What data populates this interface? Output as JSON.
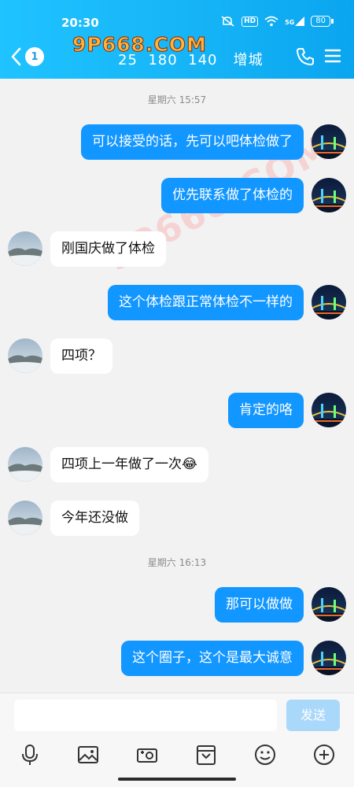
{
  "status_bar": {
    "time": "20:30",
    "network": "5G",
    "battery": "80",
    "hd_label": "HD"
  },
  "header": {
    "back_count": "1",
    "title": "25  180  140   增城"
  },
  "watermark": {
    "logo_text": "9P668.COM",
    "faint_text": "9P668.COM"
  },
  "messages": [
    {
      "type": "time",
      "text": "星期六 15:57"
    },
    {
      "type": "out",
      "text": "可以接受的话，先可以吧体检做了"
    },
    {
      "type": "out",
      "text": "优先联系做了体检的"
    },
    {
      "type": "in",
      "text": "刚国庆做了体检"
    },
    {
      "type": "out",
      "text": "这个体检跟正常体检不一样的"
    },
    {
      "type": "in",
      "text": "四项？"
    },
    {
      "type": "out",
      "text": "肯定的咯"
    },
    {
      "type": "in",
      "text": "四项上一年做了一次😂"
    },
    {
      "type": "in",
      "text": "今年还没做"
    },
    {
      "type": "time",
      "text": "星期六 16:13"
    },
    {
      "type": "out",
      "text": "那可以做做"
    },
    {
      "type": "out",
      "text": "这个圈子，这个是最大诚意"
    }
  ],
  "input": {
    "placeholder": "",
    "send_label": "发送"
  },
  "toolbar_icons": [
    "microphone-icon",
    "image-icon",
    "camera-icon",
    "video-card-icon",
    "emoji-icon",
    "plus-icon"
  ],
  "colors": {
    "header_blue": "#16b4f7",
    "bubble_out": "#1296ff",
    "send_disabled": "#a9d8fb"
  }
}
